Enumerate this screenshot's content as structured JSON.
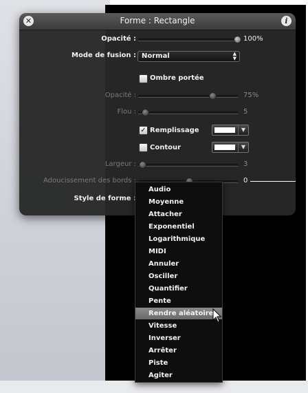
{
  "window": {
    "title": "Forme : Rectangle",
    "close_icon": "close-icon",
    "info_icon": "info-icon"
  },
  "params": {
    "opacity": {
      "label": "Opacité :",
      "value": "100%",
      "fraction": 1.0
    },
    "blend": {
      "label": "Mode de fusion :",
      "value": "Normal"
    },
    "drop_shadow": {
      "label": "Ombre portée",
      "checked": false
    },
    "shadow_opacity": {
      "label": "Opacité :",
      "value": "75%",
      "fraction": 0.75
    },
    "blur": {
      "label": "Flou :",
      "value": "5",
      "fraction": 0.0
    },
    "fill": {
      "label": "Remplissage",
      "checked": true,
      "color": "#ffffff"
    },
    "outline": {
      "label": "Contour",
      "checked": false,
      "color": "#ffffff"
    },
    "width": {
      "label": "Largeur :",
      "value": "3",
      "fraction": 0.0
    },
    "feather": {
      "label": "Adoucissement des bords :",
      "value": "0",
      "fraction": 0.5
    },
    "shape_style": {
      "label": "Style de forme :"
    }
  },
  "menu": {
    "items": [
      "Audio",
      "Moyenne",
      "Attacher",
      "Exponentiel",
      "Logarithmique",
      "MIDI",
      "Annuler",
      "Osciller",
      "Quantifier",
      "Pente",
      "Rendre aléatoire",
      "Vitesse",
      "Inverser",
      "Arrêter",
      "Piste",
      "Agiter"
    ],
    "highlighted": "Rendre aléatoire"
  },
  "colors": {
    "hud_bg": "#282828",
    "highlight": "#7b7b7b",
    "text": "#f0f0f0"
  }
}
